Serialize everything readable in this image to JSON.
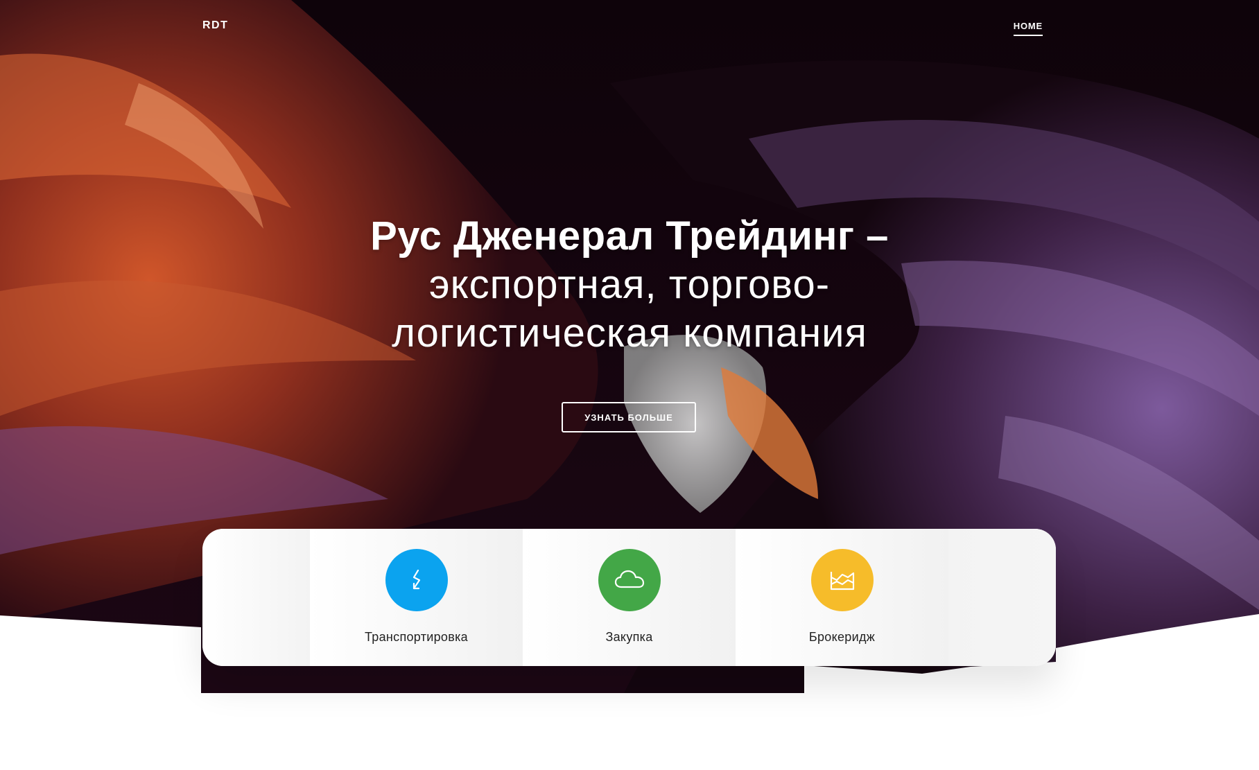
{
  "nav": {
    "brand": "RDT",
    "home_label": "HOME"
  },
  "hero": {
    "title": "Рус Дженерал Трейдинг –",
    "subtitle": "экспортная, торгово-логистическая компания",
    "cta_label": "УЗНАТЬ БОЛЬШЕ"
  },
  "services": [
    {
      "label": "Транспортировка",
      "icon": "lightning-arrow-icon",
      "color": "#0ba3ef"
    },
    {
      "label": "Закупка",
      "icon": "cloud-icon",
      "color": "#43a747"
    },
    {
      "label": "Брокеридж",
      "icon": "area-chart-icon",
      "color": "#f6bc2a"
    }
  ],
  "colors": {
    "hero_dark": "#120510",
    "canyon_orange": "#b8441f",
    "canyon_purple": "#6a4a8c",
    "text_dark": "#222222"
  }
}
